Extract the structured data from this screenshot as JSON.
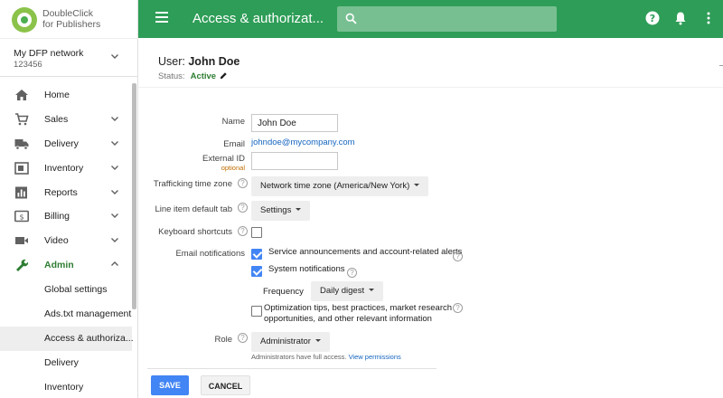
{
  "brand": {
    "line1": "DoubleClick",
    "line2": "for Publishers"
  },
  "network": {
    "name": "My DFP network",
    "id": "123456"
  },
  "nav": {
    "items": [
      {
        "label": "Home"
      },
      {
        "label": "Sales"
      },
      {
        "label": "Delivery"
      },
      {
        "label": "Inventory"
      },
      {
        "label": "Reports"
      },
      {
        "label": "Billing"
      },
      {
        "label": "Video"
      },
      {
        "label": "Admin"
      }
    ],
    "admin_sub": [
      {
        "label": "Global settings"
      },
      {
        "label": "Ads.txt management"
      },
      {
        "label": "Access & authoriza..."
      },
      {
        "label": "Delivery"
      },
      {
        "label": "Inventory"
      }
    ]
  },
  "header": {
    "title": "Access & authorizat...",
    "search_placeholder": ""
  },
  "user": {
    "prefix": "User:",
    "name": "John Doe",
    "status_label": "Status:",
    "status_value": "Active"
  },
  "form": {
    "name_label": "Name",
    "name_value": "John Doe",
    "email_label": "Email",
    "email_value": "johndoe@mycompany.com",
    "external_id_label": "External ID",
    "external_id_sub": "optional",
    "external_id_value": "",
    "tz_label": "Trafficking time zone",
    "tz_value": "Network time zone (America/New York)",
    "tab_label": "Line item default tab",
    "tab_value": "Settings",
    "shortcuts_label": "Keyboard shortcuts",
    "notif_label": "Email notifications",
    "notif_service": "Service announcements and account-related alerts",
    "notif_system": "System notifications",
    "frequency_label": "Frequency",
    "frequency_value": "Daily digest",
    "notif_tips_1": "Optimization tips, best practices, market research",
    "notif_tips_2": "opportunities, and other relevant information",
    "role_label": "Role",
    "role_value": "Administrator",
    "role_note": "Administrators have full access.",
    "role_link": "View permissions"
  },
  "actions": {
    "save": "SAVE",
    "cancel": "CANCEL"
  },
  "colors": {
    "header": "#2e9d57",
    "accent": "#4285f4",
    "active": "#2e7d32",
    "link": "#1565c0"
  }
}
